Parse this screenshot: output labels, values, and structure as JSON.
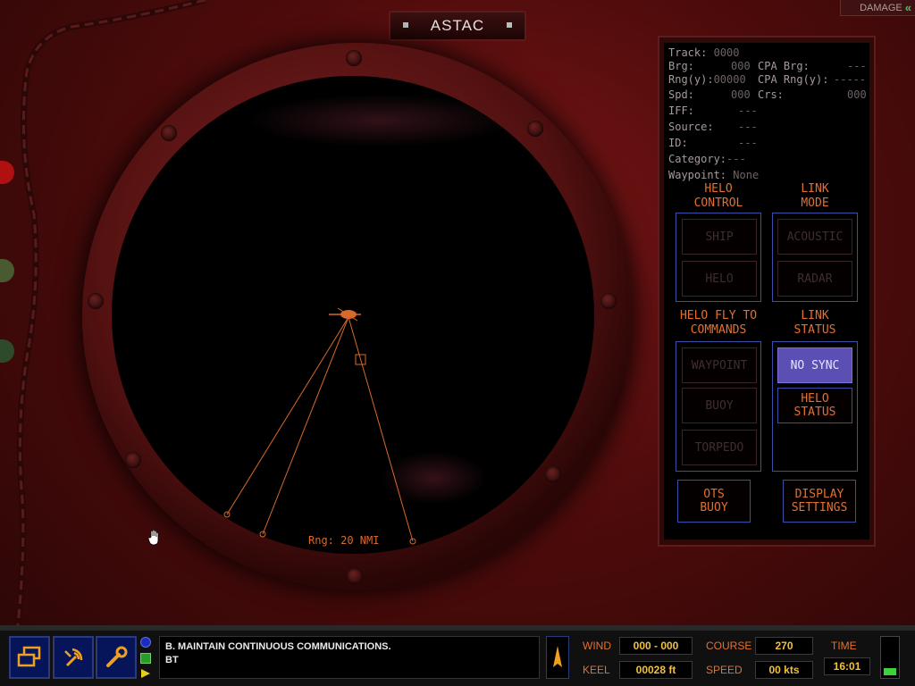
{
  "window": {
    "title": "ASTAC",
    "damage_label": "DAMAGE"
  },
  "scope": {
    "range_label": "Rng:  20 NMI"
  },
  "track_info": {
    "track": {
      "label": "Track:",
      "value": "0000"
    },
    "brg": {
      "label": "Brg:",
      "value": "000"
    },
    "cpa_brg": {
      "label": "CPA Brg:",
      "value": "---"
    },
    "rng": {
      "label": "Rng(y):",
      "value": "00000"
    },
    "cpa_rng": {
      "label": "CPA Rng(y):",
      "value": "-----"
    },
    "spd": {
      "label": "Spd:",
      "value": "000"
    },
    "crs": {
      "label": "Crs:",
      "value": "000"
    },
    "iff": {
      "label": "IFF:",
      "value": "---"
    },
    "source": {
      "label": "Source:",
      "value": "---"
    },
    "id": {
      "label": "ID:",
      "value": "---"
    },
    "category": {
      "label": "Category:",
      "value": "---"
    },
    "waypoint": {
      "label": "Waypoint:",
      "value": "None"
    }
  },
  "helo_control": {
    "title": "HELO\nCONTROL",
    "ship": "SHIP",
    "helo": "HELO"
  },
  "link_mode": {
    "title": "LINK\nMODE",
    "acoustic": "ACOUSTIC",
    "radar": "RADAR"
  },
  "helo_fly_to": {
    "title": "HELO FLY TO\nCOMMANDS",
    "waypoint": "WAYPOINT",
    "buoy": "BUOY",
    "torpedo": "TORPEDO"
  },
  "link_status": {
    "title": "LINK\nSTATUS",
    "sync": "NO SYNC",
    "helo_status": "HELO\nSTATUS"
  },
  "bottom_buttons": {
    "ots_buoy": "OTS\nBUOY",
    "display_settings": "DISPLAY\nSETTINGS"
  },
  "message": {
    "line1": "B. MAINTAIN CONTINUOUS COMMUNICATIONS.",
    "line2": "BT"
  },
  "status": {
    "wind_label": "WIND",
    "wind_value": "000 - 000",
    "keel_label": "KEEL",
    "keel_value": "00028 ft",
    "course_label": "COURSE",
    "course_value": "270",
    "speed_label": "SPEED",
    "speed_value": "00 kts",
    "time_label": "TIME",
    "time_value": "16:01"
  },
  "colors": {
    "accent": "#e4702e",
    "link_blue": "#3b4ea8",
    "sync_bg": "#5b4fb3",
    "value_yellow": "#f0c040"
  }
}
